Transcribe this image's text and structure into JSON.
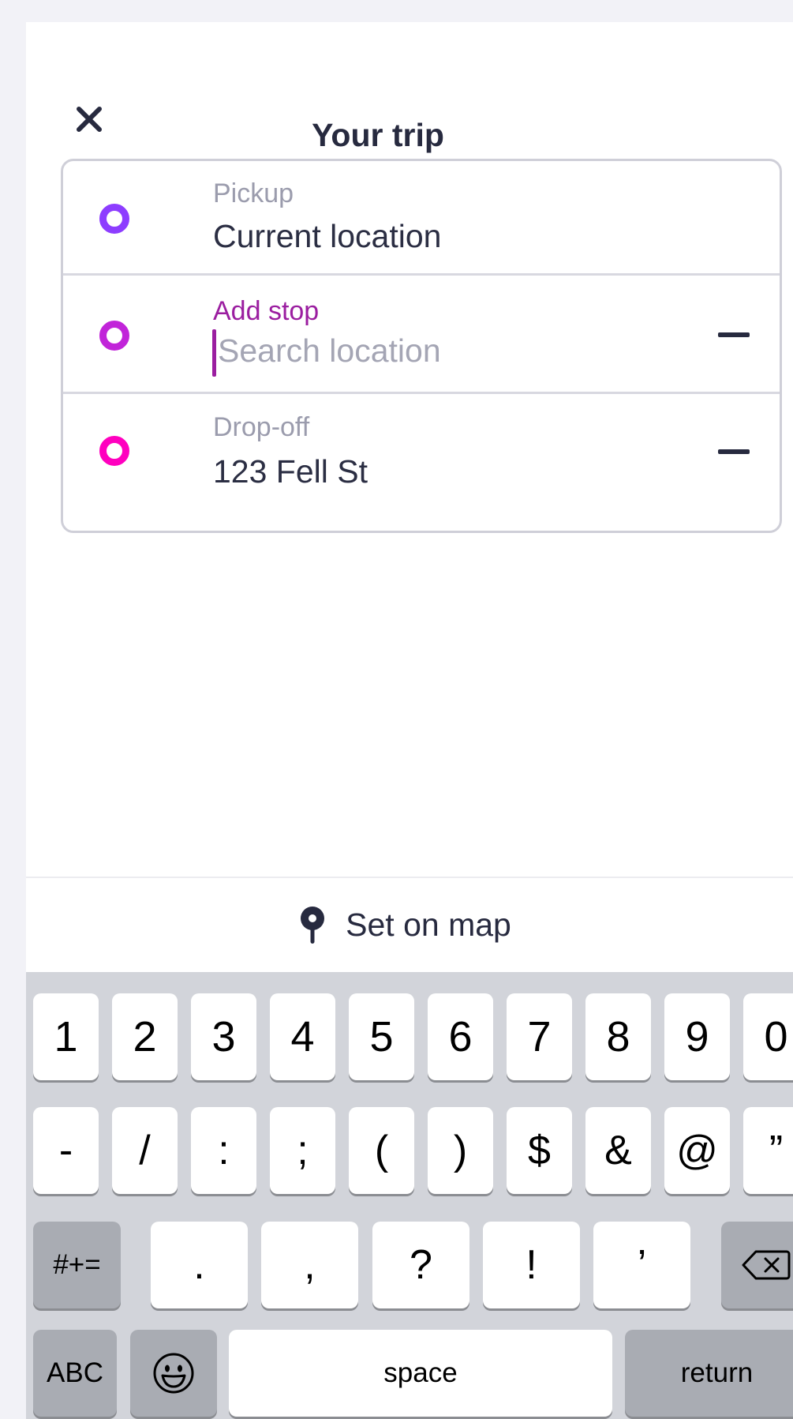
{
  "header": {
    "title": "Your trip"
  },
  "trip": {
    "pickup": {
      "label": "Pickup",
      "value": "Current location",
      "color": "#8d3dff"
    },
    "stop": {
      "label": "Add stop",
      "placeholder": "Search location",
      "color": "#c124d9",
      "label_color": "#9b1ea0"
    },
    "dropoff": {
      "label": "Drop-off",
      "value": "123 Fell St",
      "color": "#ff00bf"
    }
  },
  "set_on_map": {
    "label": "Set on map",
    "icon": "map-pin-icon"
  },
  "keyboard": {
    "row1": [
      "1",
      "2",
      "3",
      "4",
      "5",
      "6",
      "7",
      "8",
      "9",
      "0"
    ],
    "row2": [
      "-",
      "/",
      ":",
      ";",
      "(",
      ")",
      "$",
      "&",
      "@",
      "”"
    ],
    "row3_left": "#+=",
    "row3": [
      ".",
      ",",
      "?",
      "!",
      "’"
    ],
    "row3_right_icon": "backspace-icon",
    "row4": {
      "abc": "ABC",
      "emoji_icon": "emoji-icon",
      "space": "space",
      "return": "return"
    }
  }
}
